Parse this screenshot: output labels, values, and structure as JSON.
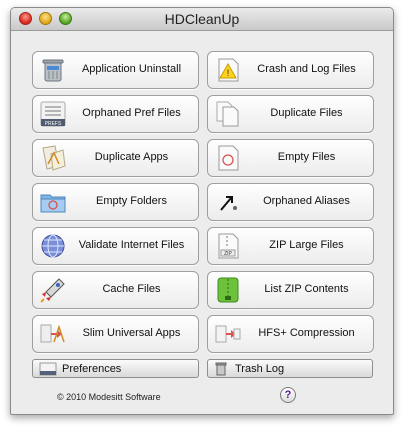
{
  "window": {
    "title": "HDCleanUp"
  },
  "buttons": {
    "application_uninstall": "Application Uninstall",
    "crash_log_files": "Crash and Log Files",
    "orphaned_pref_files": "Orphaned Pref Files",
    "duplicate_files": "Duplicate Files",
    "duplicate_apps": "Duplicate Apps",
    "empty_files": "Empty Files",
    "empty_folders": "Empty Folders",
    "orphaned_aliases": "Orphaned Aliases",
    "validate_internet_files": "Validate Internet Files",
    "zip_large_files": "ZIP Large Files",
    "cache_files": "Cache Files",
    "list_zip_contents": "List ZIP Contents",
    "slim_universal_apps": "Slim Universal Apps",
    "hfs_compression": "HFS+ Compression"
  },
  "icons": {
    "prefs_text": "PREFS",
    "zip_text": "ZIP"
  },
  "bottom": {
    "preferences": "Preferences",
    "trash_log": "Trash Log",
    "copyright": "© 2010 Modesitt Software",
    "help": "?"
  }
}
